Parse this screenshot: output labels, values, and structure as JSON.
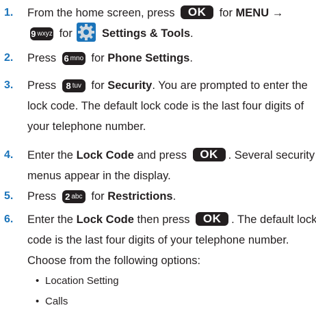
{
  "keys": {
    "ok": "OK",
    "k9_digit": "9",
    "k9_letters": "wxyz",
    "k6_digit": "6",
    "k6_letters": "mno",
    "k8_digit": "8",
    "k8_letters": "tuv",
    "k2_digit": "2",
    "k2_letters": "abc"
  },
  "steps": [
    {
      "number": "1.",
      "l1_a": "From the home screen, press",
      "l1_b": "for",
      "l1_menu": "MENU",
      "l1_arrow": "→",
      "l2_for": "for",
      "l2_settings": "Settings & Tools",
      "l2_end": "."
    },
    {
      "number": "2.",
      "press": "Press",
      "for": "for",
      "target": "Phone Settings",
      "end": "."
    },
    {
      "number": "3.",
      "press": "Press",
      "for": "for",
      "target": "Security",
      "rest1": ". You are prompted to enter the",
      "line2": "lock code. The default lock code is the last four digits of",
      "line3": "your telephone number."
    },
    {
      "number": "4.",
      "a": "Enter the",
      "lockcode": "Lock Code",
      "b": "and press",
      "c": ". Several security",
      "line2": "menus appear in the display."
    },
    {
      "number": "5.",
      "press": "Press",
      "for": "for",
      "target": "Restrictions",
      "end": "."
    },
    {
      "number": "6.",
      "a": "Enter the",
      "lockcode": "Lock Code",
      "b": "then press",
      "c": ". The default lock",
      "line2": "code is the last four digits of your telephone number.",
      "line3": "Choose from the following options:"
    }
  ],
  "options": [
    "Location Setting",
    "Calls"
  ]
}
